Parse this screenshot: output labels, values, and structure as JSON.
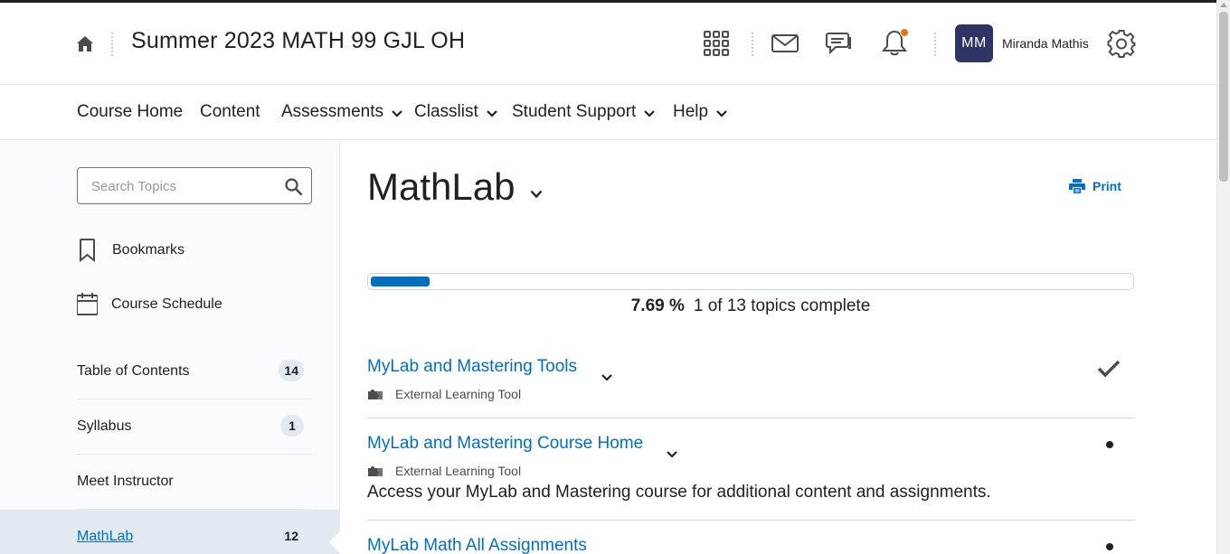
{
  "header": {
    "course_title": "Summer 2023 MATH 99 GJL OH",
    "avatar_initials": "MM",
    "user_name": "Miranda Mathis",
    "icons": [
      "home-icon",
      "waffle-grid-icon",
      "mail-icon",
      "chat-icon",
      "bell-icon",
      "gear-icon"
    ],
    "notification_color": "#e87511",
    "avatar_color": "#2e3463"
  },
  "nav": {
    "items": [
      {
        "label": "Course Home",
        "dropdown": false
      },
      {
        "label": "Content",
        "dropdown": false
      },
      {
        "label": "Assessments",
        "dropdown": true
      },
      {
        "label": "Classlist",
        "dropdown": true
      },
      {
        "label": "Student Support",
        "dropdown": true
      },
      {
        "label": "Help",
        "dropdown": true
      }
    ]
  },
  "sidebar": {
    "search_placeholder": "Search Topics",
    "links": [
      {
        "label": "Bookmarks",
        "icon": "bookmark-icon"
      },
      {
        "label": "Course Schedule",
        "icon": "calendar-icon"
      }
    ],
    "toc": [
      {
        "label": "Table of Contents",
        "count": "14"
      },
      {
        "label": "Syllabus",
        "count": "1"
      },
      {
        "label": "Meet Instructor",
        "count": ""
      },
      {
        "label": "MathLab",
        "count": "12",
        "active": true
      }
    ]
  },
  "main": {
    "title": "MathLab",
    "print_label": "Print",
    "progress": {
      "percent_label": "7.69 %",
      "status_text": "1 of 13 topics complete",
      "fraction": 0.0769
    },
    "topics": [
      {
        "title": "MyLab and Mastering Tools",
        "type": "External Learning Tool",
        "description": "",
        "status": "complete"
      },
      {
        "title": "MyLab and Mastering Course Home",
        "type": "External Learning Tool",
        "description": "Access your MyLab and Mastering course for additional content and assignments.",
        "status": "incomplete"
      },
      {
        "title": "MyLab Math All Assignments",
        "type": "",
        "description": "",
        "status": "incomplete"
      }
    ]
  },
  "colors": {
    "link": "#006fbf",
    "text": "#202122",
    "sidebar_bg": "#f9fbff",
    "active_bg": "#e3e9f1"
  }
}
